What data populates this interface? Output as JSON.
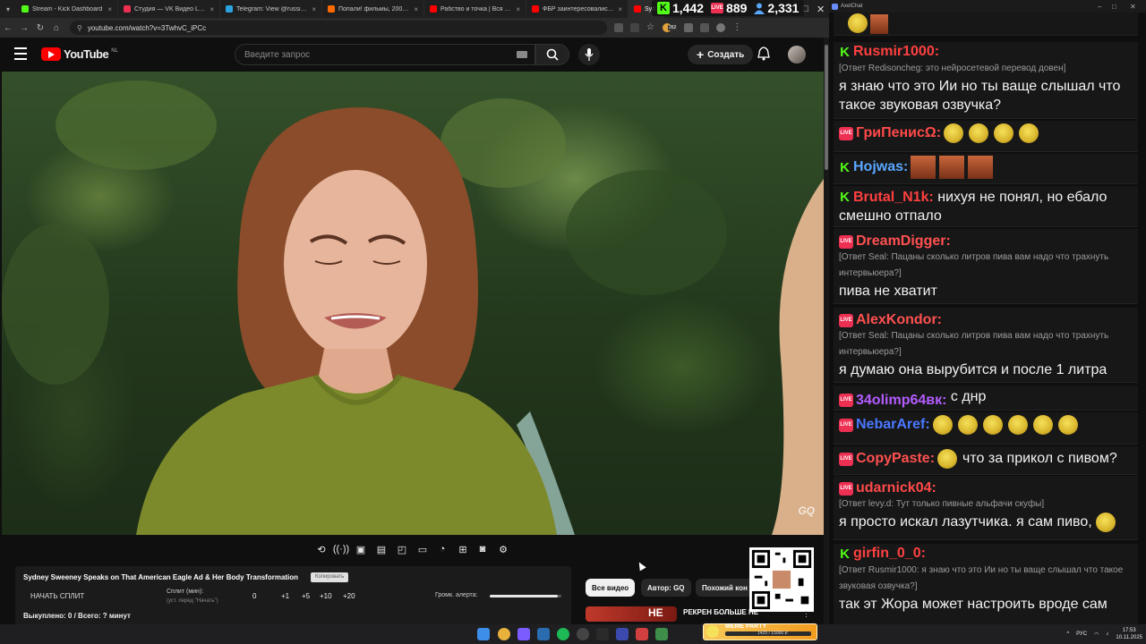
{
  "browser": {
    "tabs": [
      {
        "title": "Stream - Kick Dashboard",
        "color": "#53fc18"
      },
      {
        "title": "Студия — VK Видео Live",
        "color": "#ed2f52"
      },
      {
        "title": "Telegram: View @russiainmyr",
        "color": "#2aa3e0"
      },
      {
        "title": "Попали! фильмы, 2009, дата в",
        "color": "#ff6a00"
      },
      {
        "title": "Рабство и точка | Вся правда",
        "color": "#ff0000"
      },
      {
        "title": "ФБР заинтересовались опол",
        "color": "#ff0000"
      },
      {
        "title": "Syd",
        "color": "#ff0000",
        "active": true
      }
    ],
    "url": "youtube.com/watch?v=3TwhvC_iPCc",
    "extension_badge": "262"
  },
  "stream_stats": {
    "kick_viewers": "1,442",
    "vk_viewers": "889",
    "total_viewers": "2,331",
    "vk_label": "LIVE"
  },
  "youtube": {
    "logo_text": "YouTube",
    "region": "NL",
    "search_placeholder": "Введите запрос",
    "create_label": "Создать",
    "watermark": "GQ",
    "chips": [
      "Все видео",
      "Автор: GQ",
      "Похожий кон"
    ],
    "rec_thumb_text": "НЕ",
    "rec_title": "РЕКРЕН БОЛЬШЕ НЕ"
  },
  "split_panel": {
    "title": "Sydney Sweeney Speaks on That American Eagle Ad & Her Body Transformation",
    "copy_label": "Копировать",
    "start_split": "НАЧАТЬ СПЛИТ",
    "split_min_label": "Сплит (мин):",
    "split_note": "(уст. перед \"Начать\")",
    "split_value": "0",
    "increments": [
      "+1",
      "+5",
      "+10",
      "+20"
    ],
    "alert_volume_label": "Громк. алерта:",
    "alert_volume": 0.95,
    "done_status": "Выкуплено: 0 / Всего: ? минут"
  },
  "chat": {
    "window_title": "AxelChat",
    "messages": [
      {
        "platform": "kick",
        "user": "Rusmir1000:",
        "color": "#ff4040",
        "reply": "[Ответ Redisoncheg: это нейросетевой перевод довен]",
        "text": "я знаю что это Ии но ты ваще слышал что такое звуковая озвучка?"
      },
      {
        "platform": "vk",
        "user": "ГриПенисΩ:",
        "color": "#ff4a4a",
        "emotes": 4
      },
      {
        "platform": "kick",
        "user": "Hojwas:",
        "color": "#5aa7ff",
        "face_emotes": 3
      },
      {
        "platform": "kick",
        "user": "Brutal_N1k:",
        "color": "#ff4040",
        "inline": "нихуя не понял, но ебало смешно отпало"
      },
      {
        "platform": "vk",
        "user": "DreamDigger:",
        "color": "#ff5050",
        "reply": "[Ответ Seal: Пацаны сколько литров пива вам надо что трахнуть интервьюера?]",
        "text": "пива не хватит"
      },
      {
        "platform": "vk",
        "user": "AlexKondor:",
        "color": "#ff5050",
        "reply": "[Ответ Seal: Пацаны сколько литров пива вам надо что трахнуть интервьюера?]",
        "text": "я думаю она вырубится и после 1 литра"
      },
      {
        "platform": "vk",
        "user": "34olimp64вк:",
        "color": "#b45cff",
        "inline": "с днр"
      },
      {
        "platform": "vk",
        "user": "NebarAref:",
        "color": "#4a78ff",
        "emotes": 6
      },
      {
        "platform": "vk",
        "user": "CopyPaste:",
        "color": "#ff5050",
        "emotes": 1,
        "inline": "что за прикол с пивом?"
      },
      {
        "platform": "vk",
        "user": "udarnick04:",
        "color": "#ff4a4a",
        "reply": "[Ответ levy.d: Тут только пивные альфачи скуфы]",
        "text": "я просто искал лазутчика. я сам пиво,"
      },
      {
        "platform": "kick",
        "user": "girfin_0_0:",
        "color": "#ff4040",
        "reply": "[Ответ Rusmir1000: я знаю что это Ии но ты ваще слышал что такое звуковая озвучка?]",
        "text": "так эт Жора может настроить вроде сам"
      }
    ]
  },
  "taskbar": {
    "meme_label": "MEME PARTY",
    "meme_progress": "1425 / 15000 ₽",
    "lang": "РУС",
    "time": "17:53",
    "date": "10.11.2025"
  }
}
